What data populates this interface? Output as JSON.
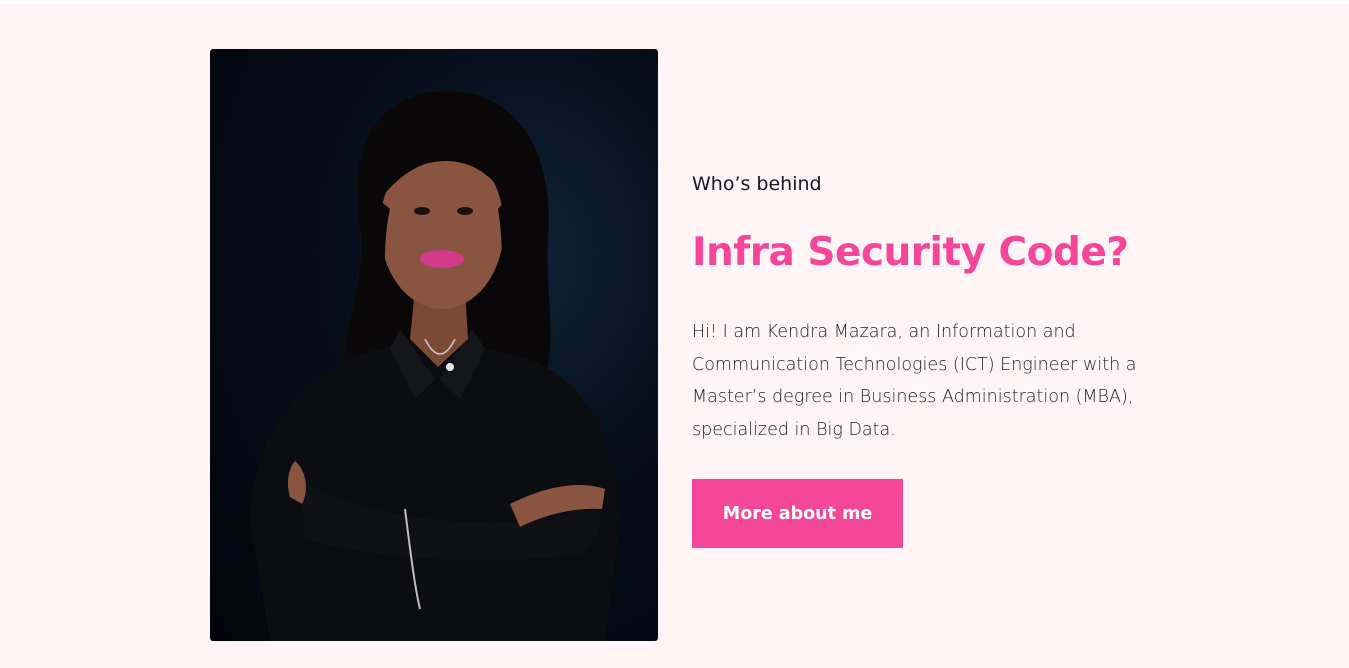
{
  "about": {
    "eyebrow": "Who’s behind",
    "headline": "Infra Security Code?",
    "bio": "Hi! I am Kendra Mazara, an Information and Communication Technologies (ICT) Engineer with a Master’s degree in Business Administration (MBA), specialized in Big Data.",
    "cta_label": "More about me"
  },
  "colors": {
    "accent": "#f5469a",
    "background": "#fff5f6",
    "text": "#141729"
  }
}
